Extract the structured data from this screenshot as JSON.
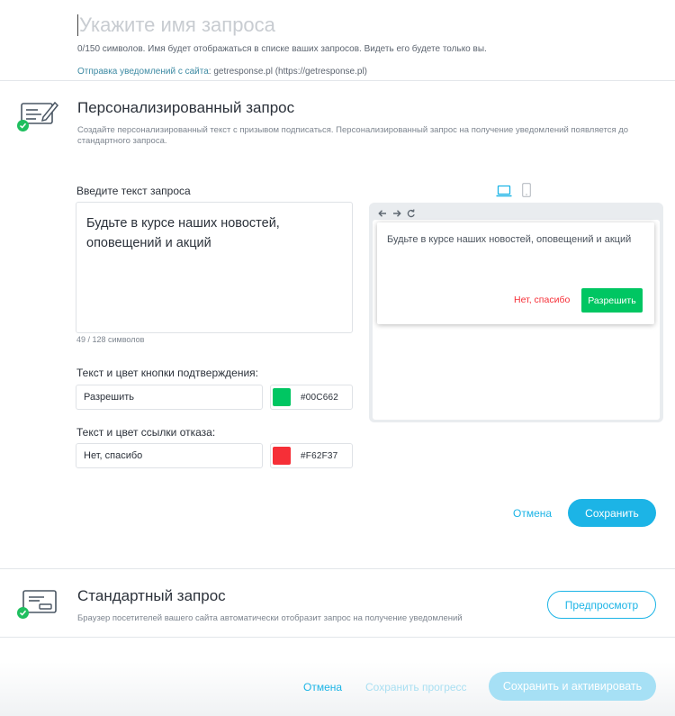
{
  "name_field": {
    "placeholder": "Укажите имя запроса",
    "hint": "0/150 символов. Имя будет отображаться в списке ваших запросов. Видеть его будете только вы.",
    "notify_label": "Отправка уведомлений с сайта",
    "notify_value": ": getresponse.pl (https://getresponse.pl)"
  },
  "personalized": {
    "icon": "form-edit-icon",
    "title": "Персонализированный запрос",
    "description": "Создайте персонализированный текст с призывом подписаться. Персонализированный запрос на получение уведомлений появляется до стандартного запроса.",
    "text_label": "Введите текст запроса",
    "text_value": "Будьте в курсе наших новостей, оповещений и акций",
    "counter": "49 / 128 символов",
    "confirm_label": "Текст и цвет кнопки подтверждения:",
    "confirm_text": "Разрешить",
    "confirm_color": "#00C662",
    "deny_label": "Текст и цвет ссылки отказа:",
    "deny_text": "Нет, спасибо",
    "deny_color": "#F62F37",
    "cancel": "Отмена",
    "save": "Сохранить"
  },
  "preview": {
    "devices": [
      "laptop-icon",
      "phone-icon"
    ],
    "nav_icons": [
      "arrow-left-icon",
      "arrow-right-icon",
      "reload-icon"
    ],
    "popup_text": "Будьте в курсе наших новостей, оповещений и акций",
    "deny": "Нет, спасибо",
    "allow": "Разрешить"
  },
  "standard": {
    "icon": "form-card-icon",
    "title": "Стандартный запрос",
    "description": "Браузер посетителей вашего сайта автоматически отобразит запрос на получение уведомлений",
    "preview_button": "Предпросмотр"
  },
  "footer": {
    "cancel": "Отмена",
    "save_progress": "Сохранить прогресс",
    "save_activate": "Сохранить и активировать"
  },
  "colors": {
    "accent": "#1cb4e6",
    "success": "#1fbf5f",
    "allow_button": "#00C662",
    "deny_link": "#F62F37"
  }
}
